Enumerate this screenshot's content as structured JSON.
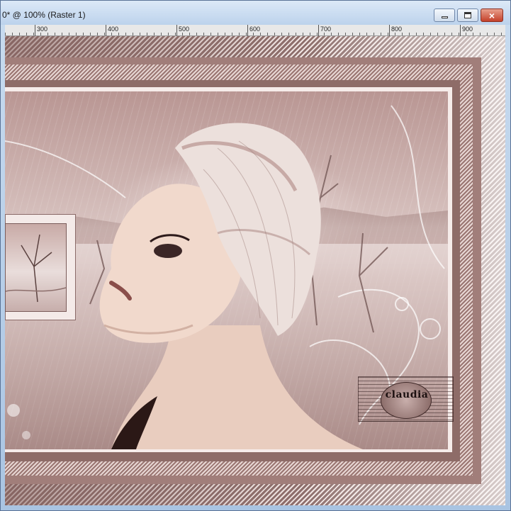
{
  "window": {
    "title": "0* @ 100% (Raster 1)",
    "buttons": {
      "minimize": "minimize",
      "maximize": "maximize",
      "close": "×"
    }
  },
  "ruler": {
    "labels": [
      "300",
      "400",
      "500",
      "600",
      "700",
      "800",
      "900"
    ]
  },
  "canvas": {
    "watermark_text": "claudia"
  },
  "icons": {
    "minimize": "minimize-icon",
    "maximize": "maximize-icon",
    "close": "close-icon"
  },
  "colors": {
    "titlebar": "#bcd2ec",
    "close_button": "#c4402a",
    "frame_mauve": "#a17e7a",
    "photo_tone": "#d8c3c0"
  }
}
